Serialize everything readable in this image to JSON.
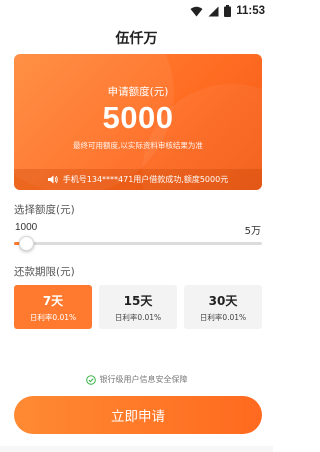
{
  "status_bar": {
    "time": "11:53",
    "icons": [
      "wifi-icon",
      "signal-icon",
      "battery-icon"
    ]
  },
  "app": {
    "title": "伍仟万"
  },
  "quota_card": {
    "label": "申请额度(元)",
    "amount": "5000",
    "subtitle": "最终可用额度,以实际资料审核结果为准",
    "notice_icon": "speaker-icon",
    "notice": "手机号134****471用户借款成功,额度5000元",
    "background_color": "#ff6d23"
  },
  "amount_selector": {
    "label": "选择额度(元)",
    "min_label": "1000",
    "max_label": "5万",
    "value_fraction": 0.03,
    "accent_color": "#ff7a2e"
  },
  "term_selector": {
    "label": "还款期限(元)",
    "options": [
      {
        "days": "7天",
        "rate": "日利率0.01%",
        "selected": true
      },
      {
        "days": "15天",
        "rate": "日利率0.01%",
        "selected": false
      },
      {
        "days": "30天",
        "rate": "日利率0.01%",
        "selected": false
      }
    ]
  },
  "security": {
    "icon": "shield-check-icon",
    "text": "银行级用户信息安全保障",
    "icon_color": "#3cb44b"
  },
  "apply_button": {
    "label": "立即申请"
  }
}
